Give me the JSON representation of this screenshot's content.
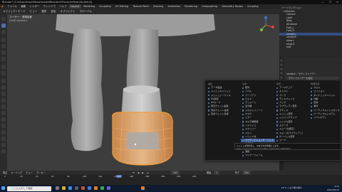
{
  "window": {
    "title": "Blender* [C:¥Users¥user¥Downloads¥Blender¥Character¥sandal.blend]",
    "controls": "—  ☐  ✕"
  },
  "menubar": {
    "items": [
      "ファイル",
      "編集",
      "レンダー",
      "ウィンドウ",
      "ヘルプ"
    ],
    "workspaces": [
      "Layout",
      "Modeling",
      "Sculpting",
      "UV Editing",
      "Texture Paint",
      "Shading",
      "Animation",
      "Rendering",
      "Compositing",
      "Geometry Nodes",
      "Scripting"
    ],
    "active_workspace": "Layout",
    "scene": "Scene",
    "view_layer": "ViewLayer"
  },
  "toolstrip": {
    "items": [
      "オブジェクトモード",
      "ビュー",
      "選択",
      "追加",
      "オブジェクト",
      "グローバル"
    ]
  },
  "viewport": {
    "view_name": "ユーザー・透視投影",
    "collection": "(143) sandal.L",
    "sidebar_hint": "ビュー"
  },
  "outliner": {
    "rows": [
      {
        "label": "シーンコレクション",
        "sel": false
      },
      {
        "label": "Collection",
        "sel": false
      },
      {
        "label": "Camera",
        "sel": false
      },
      {
        "label": "Light",
        "sel": false
      },
      {
        "label": "Body",
        "sel": false
      },
      {
        "label": "Armature",
        "sel": false
      },
      {
        "label": "Foot_L",
        "sel": false
      },
      {
        "label": "Foot_R",
        "sel": false
      },
      {
        "label": "sandal.L",
        "sel": true
      },
      {
        "label": "sandal.R",
        "sel": false
      },
      {
        "label": "strap.L",
        "sel": false
      },
      {
        "label": "strap.R",
        "sel": false
      },
      {
        "label": "sole",
        "sel": false
      }
    ]
  },
  "properties": {
    "object": "sandal.L",
    "section": "モディファイアー",
    "add_modifier": "モディファイアーを追加"
  },
  "modifier_menu": {
    "columns": [
      {
        "header": "編集",
        "items": [
          "データ転送",
          "メッシュキャッシュ",
          "メッシュシーケンス",
          "UV投影",
          "UVワープ",
          "頂点ウェイト編集",
          "頂点ウェイト合成",
          "頂点ウェイト近接"
        ]
      },
      {
        "header": "生成",
        "items": [
          "配列",
          "ベベル",
          "ブーリアン",
          "ビルド",
          "デシメート",
          "辺分離",
          "ジオメトリノード",
          "マスク",
          "ミラー",
          "マルチ解像度",
          "リメッシュ",
          "スクリュー",
          "スキン",
          "ソリッド化",
          "サブディビジョンサーフェス",
          "三角面化",
          "ボリュームからメッシュ",
          "溶接",
          "ワイヤーフレーム"
        ]
      },
      {
        "header": "変形",
        "items": [
          "アーマチュア",
          "キャスト",
          "カーブ",
          "ディスプレイス",
          "フック",
          "ラプラシアン変形",
          "ラティス",
          "メッシュ変形",
          "シュリンクラップ",
          "シンプル変形",
          "スムーズ",
          "スムーズ(補正)",
          "スムーズ(ラプラシアン)",
          "サーフェス変形",
          "ワープ",
          "波紋"
        ]
      },
      {
        "header": "物理演算",
        "items": [
          "クロス",
          "コリジョン",
          "ダイナミックペイント",
          "分解",
          "流体",
          "海洋",
          "パーティクルインスタンス",
          "パーティクルシステム",
          "ソフトボディ"
        ]
      }
    ],
    "highlighted": "サブディビジョンサーフェス"
  },
  "tooltip": {
    "line1": "メッシュを再分割し、なめらかな外観にします。",
    "line2": "Python: bpy.ops.object.modifier_add(type='SUBSURF')"
  },
  "timeline": {
    "menu": [
      "再生",
      "キーイング",
      "ビュー",
      "マーカー"
    ],
    "current_frame": "143",
    "start_label": "開始",
    "start": "1",
    "end_label": "終了",
    "end": "250",
    "ruler": [
      "0",
      "20",
      "40",
      "60",
      "80",
      "100",
      "120",
      "140",
      "160",
      "180",
      "200",
      "220",
      "240"
    ]
  },
  "statusbar": {
    "search_placeholder": "ここに入力して検索",
    "weather": "22°C くもり時々晴れ",
    "time": "9:40",
    "date": "2022/06/10",
    "version": "3.2.0"
  },
  "colors": {
    "accent": "#4d72b8",
    "selection": "#f29b35",
    "menu_highlight": "#3b5c95"
  }
}
